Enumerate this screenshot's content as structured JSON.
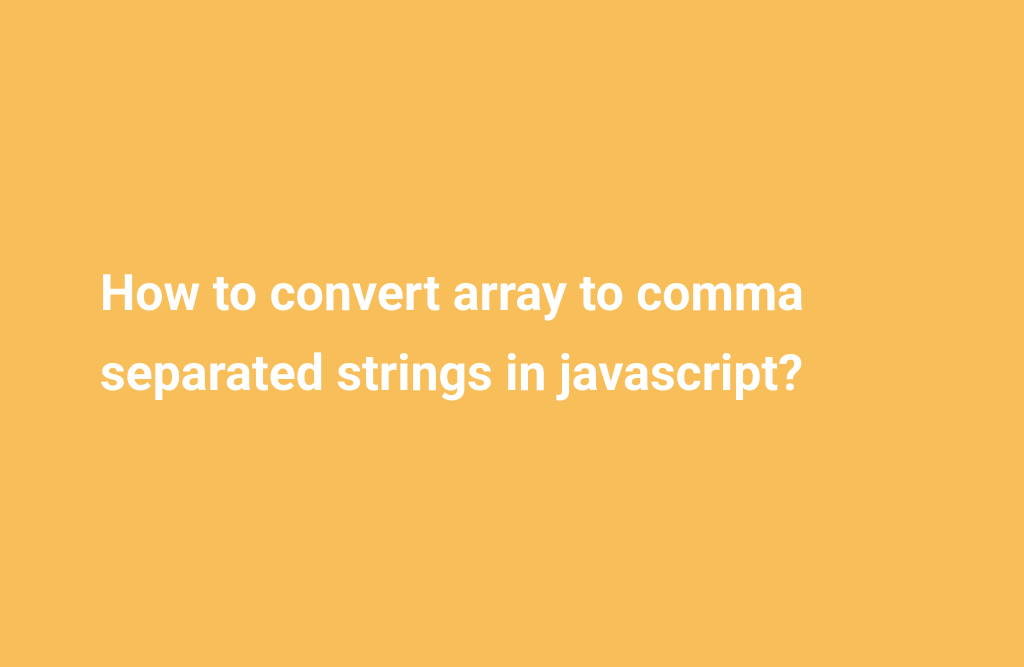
{
  "heading": "How to convert array to comma separated strings in javascript?"
}
